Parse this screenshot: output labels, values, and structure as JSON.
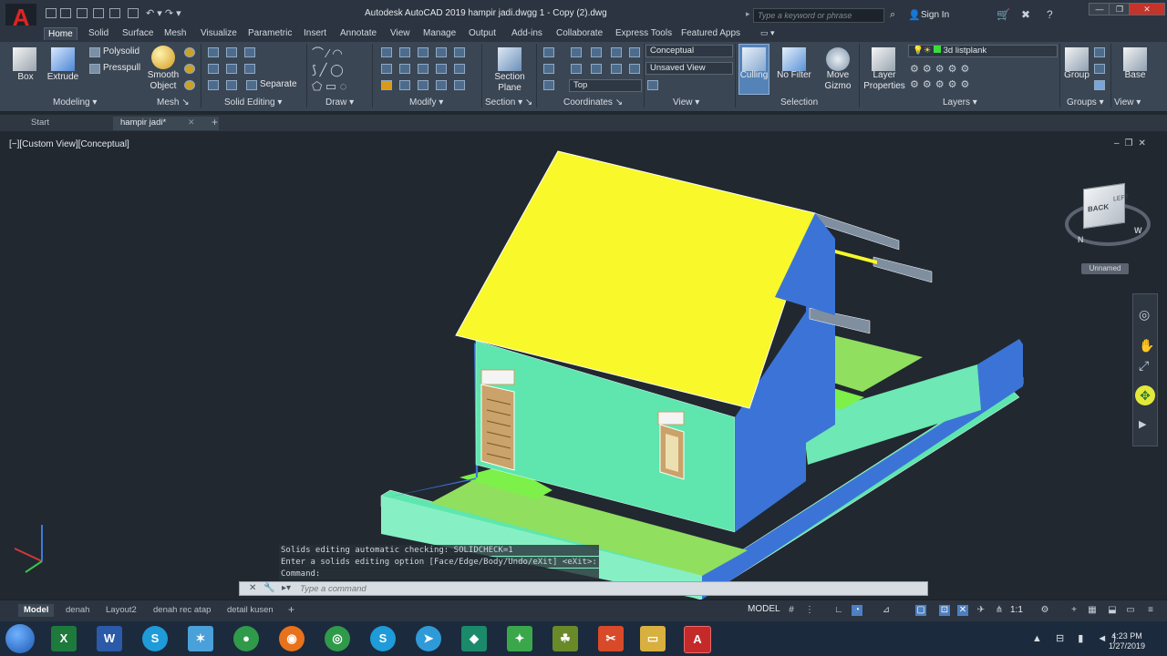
{
  "app": {
    "title": "Autodesk AutoCAD 2019      hampir jadi.dwgg 1 - Copy (2).dwg",
    "logo": "A",
    "search_placeholder": "Type a keyword or phrase",
    "sign_in": "Sign In"
  },
  "ribbon_tabs": [
    "Home",
    "Solid",
    "Surface",
    "Mesh",
    "Visualize",
    "Parametric",
    "Insert",
    "Annotate",
    "View",
    "Manage",
    "Output",
    "Add-ins",
    "Collaborate",
    "Express Tools",
    "Featured Apps"
  ],
  "ribbon": {
    "modeling": {
      "title": "Modeling",
      "box": "Box",
      "extrude": "Extrude",
      "polysolid": "Polysolid",
      "presspull": "Presspull",
      "smooth_object": "Smooth\nObject"
    },
    "mesh": {
      "title": "Mesh"
    },
    "solid_editing": {
      "title": "Solid Editing",
      "separate": "Separate"
    },
    "draw": {
      "title": "Draw"
    },
    "modify": {
      "title": "Modify"
    },
    "section": {
      "title": "Section",
      "section_plane": "Section\nPlane"
    },
    "coordinates": {
      "title": "Coordinates",
      "top": "Top"
    },
    "view": {
      "title": "View",
      "visual_style": "Conceptual",
      "saved_view": "Unsaved View"
    },
    "selection": {
      "title": "Selection",
      "culling": "Culling",
      "no_filter": "No Filter",
      "move_gizmo": "Move\nGizmo"
    },
    "layers": {
      "title": "Layers",
      "layer_properties": "Layer\nProperties",
      "current_layer": "3d listplank"
    },
    "groups": {
      "title": "Groups",
      "group": "Group"
    },
    "view2": {
      "title": "View",
      "base": "Base"
    }
  },
  "file_tabs": [
    "Start",
    "hampir jadi*"
  ],
  "viewport": {
    "label": "[−][Custom View][Conceptual]",
    "viewcube": {
      "face": "BACK",
      "side": "LEFT",
      "compass_n": "N",
      "compass_w": "W"
    },
    "ucs_name": "Unnamed"
  },
  "command": {
    "history": [
      "Solids editing automatic checking:  SOLIDCHECK=1",
      "Enter a solids editing option [Face/Edge/Body/Undo/eXit] <eXit>:",
      "Command:"
    ],
    "placeholder": "Type a command"
  },
  "layout_tabs": [
    "Model",
    "denah",
    "Layout2",
    "denah rec atap",
    "detail kusen"
  ],
  "status": {
    "model": "MODEL",
    "scale": "1:1"
  },
  "clock": {
    "time": "4:23 PM",
    "date": "1/27/2019"
  },
  "colors": {
    "roof": "#f8f82a",
    "wall": "#5ee6ae",
    "wall_side": "#3b74d6",
    "floor": "#90df5f",
    "door": "#caa26a",
    "viewport_bg": "#212830"
  }
}
